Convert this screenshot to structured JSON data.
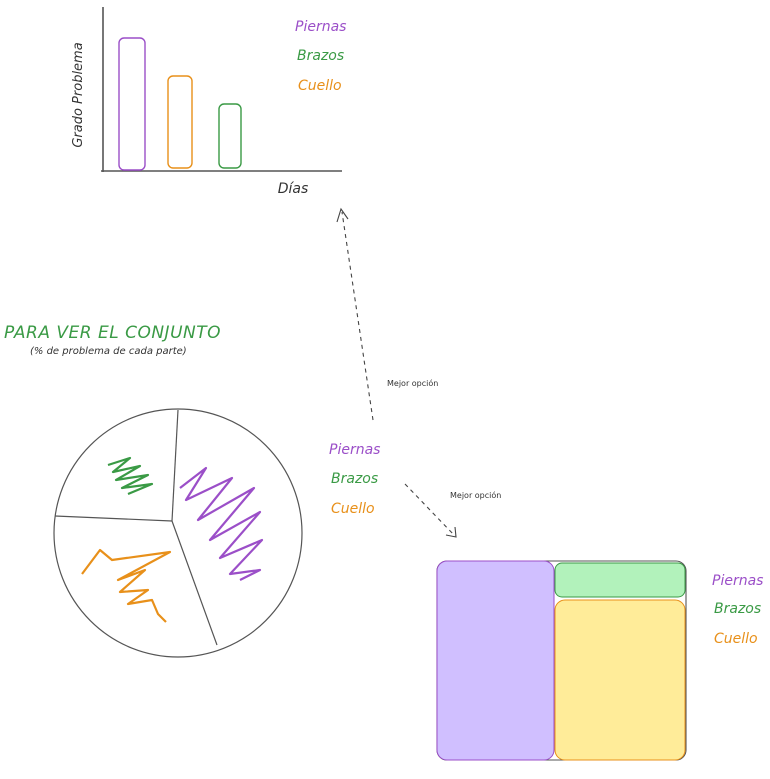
{
  "colors": {
    "piernas": "#9b4fc8",
    "brazos": "#3a9a45",
    "cuello": "#e8901a",
    "title_green": "#3a9a45",
    "ink": "#333333",
    "piernas_fill": "#d0bfff",
    "brazos_fill": "#b2f2bb",
    "cuello_fill": "#ffec99"
  },
  "legend": {
    "piernas": "Piernas",
    "brazos": "Brazos",
    "cuello": "Cuello"
  },
  "arrows": {
    "up_label": "Mejor opción",
    "down_label": "Mejor opción"
  },
  "pie_section": {
    "title": "PARA VER EL CONJUNTO",
    "subtitle": "(% de problema de cada parte)"
  },
  "chart_data": [
    {
      "type": "bar",
      "xlabel": "Días",
      "ylabel": "Grado Problema",
      "series": [
        {
          "name": "Piernas",
          "values": [
            1.0
          ]
        },
        {
          "name": "Cuello",
          "values": [
            0.72
          ]
        },
        {
          "name": "Brazos",
          "values": [
            0.5
          ]
        }
      ]
    },
    {
      "type": "pie",
      "slices": [
        {
          "name": "Piernas",
          "value": 0.46
        },
        {
          "name": "Cuello",
          "value": 0.34
        },
        {
          "name": "Brazos",
          "value": 0.2
        }
      ]
    },
    {
      "type": "treemap",
      "cells": [
        {
          "name": "Piernas",
          "value": 0.46
        },
        {
          "name": "Cuello",
          "value": 0.42
        },
        {
          "name": "Brazos",
          "value": 0.12
        }
      ]
    }
  ]
}
